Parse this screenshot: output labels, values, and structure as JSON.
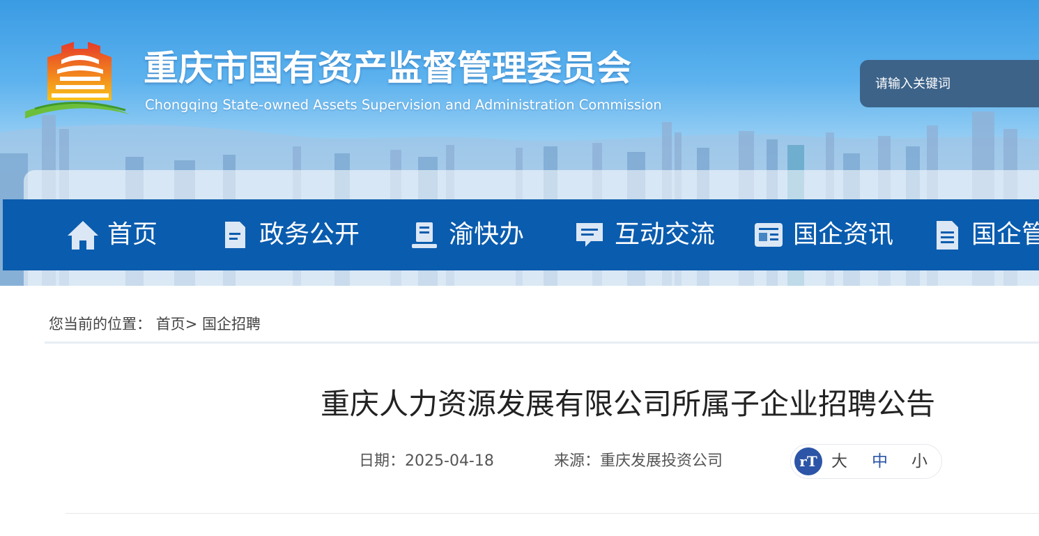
{
  "site": {
    "title": "重庆市国有资产监督管理委员会",
    "subtitle": "Chongqing State-owned Assets Supervision and Administration Commission"
  },
  "search": {
    "placeholder": "请输入关键词"
  },
  "nav": {
    "items": [
      {
        "label": "首页",
        "icon": "home-icon"
      },
      {
        "label": "政务公开",
        "icon": "document-icon"
      },
      {
        "label": "渝快办",
        "icon": "book-stand-icon"
      },
      {
        "label": "互动交流",
        "icon": "chat-icon"
      },
      {
        "label": "国企资讯",
        "icon": "news-card-icon"
      },
      {
        "label": "国企管",
        "icon": "file-lines-icon"
      }
    ]
  },
  "breadcrumb": {
    "prefix": "您当前的位置：",
    "home": "首页",
    "separator": ">",
    "current": "国企招聘"
  },
  "article": {
    "title": "重庆人力资源发展有限公司所属子企业招聘公告",
    "date_label": "日期：",
    "date": "2025-04-18",
    "source_label": "来源：",
    "source": "重庆发展投资公司"
  },
  "font_size": {
    "icon_text": "rT",
    "large": "大",
    "medium": "中",
    "small": "小",
    "selected": "中"
  },
  "colors": {
    "nav_background": "#0a5cae",
    "search_background": "#3d6389",
    "accent": "#2c55a7"
  }
}
